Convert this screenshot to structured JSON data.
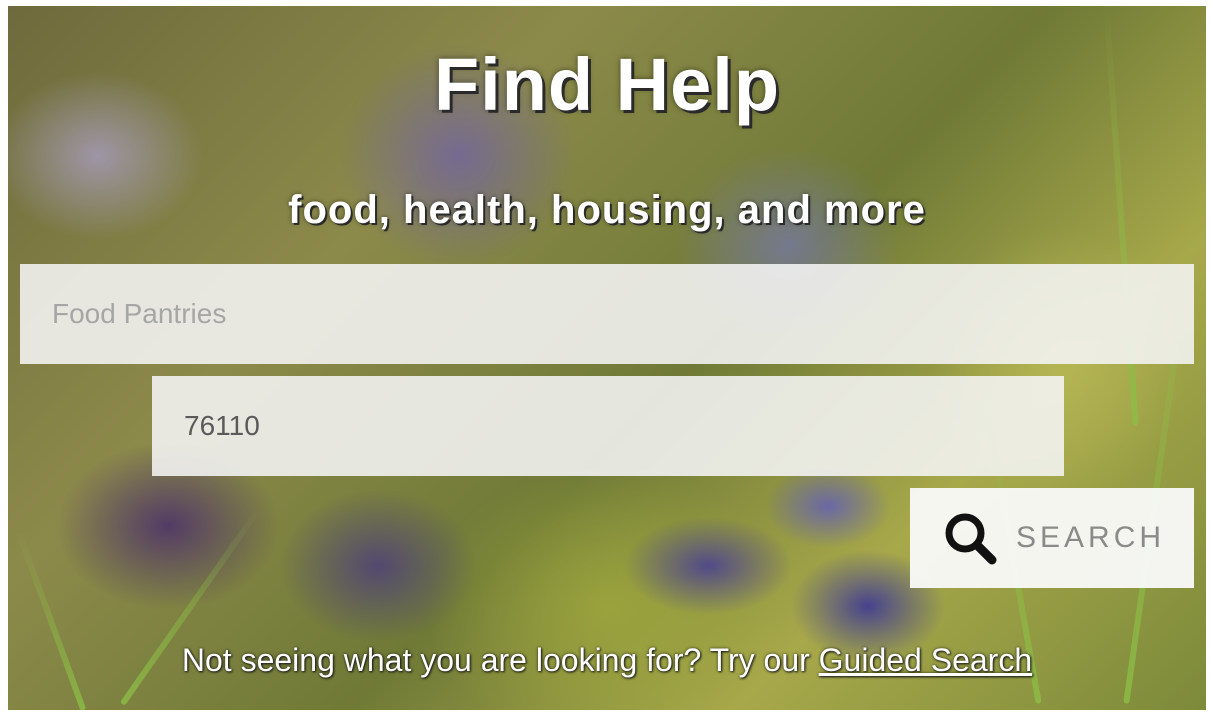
{
  "hero": {
    "title": "Find Help",
    "subtitle": "food, health, housing, and more"
  },
  "search": {
    "service_placeholder": "Food Pantries",
    "zip_value": "76110",
    "button_label": "SEARCH",
    "button_icon": "search-icon"
  },
  "footer": {
    "text": "Not seeing what you are looking for? Try our ",
    "link_label": "Guided Search"
  }
}
